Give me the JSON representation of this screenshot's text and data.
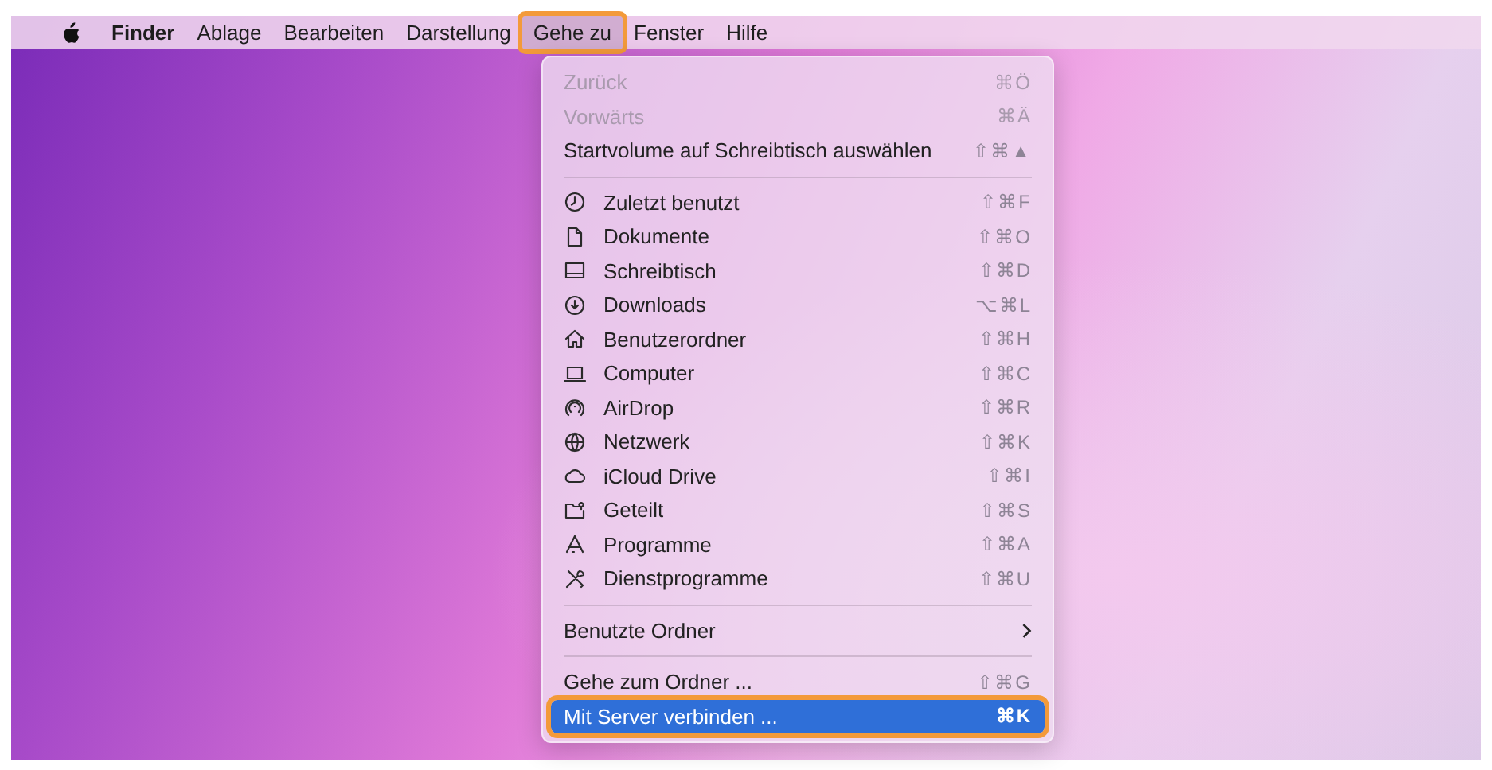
{
  "menubar": {
    "items": [
      {
        "label": "Finder",
        "bold": true,
        "selected": false,
        "outlined": false
      },
      {
        "label": "Ablage",
        "bold": false,
        "selected": false,
        "outlined": false
      },
      {
        "label": "Bearbeiten",
        "bold": false,
        "selected": false,
        "outlined": false
      },
      {
        "label": "Darstellung",
        "bold": false,
        "selected": false,
        "outlined": false
      },
      {
        "label": "Gehe zu",
        "bold": false,
        "selected": true,
        "outlined": true
      },
      {
        "label": "Fenster",
        "bold": false,
        "selected": false,
        "outlined": false
      },
      {
        "label": "Hilfe",
        "bold": false,
        "selected": false,
        "outlined": false
      }
    ]
  },
  "menu": {
    "top_items": [
      {
        "label": "Zurück",
        "shortcut": "⌘Ö",
        "disabled": true,
        "selected": false,
        "outlined": false
      },
      {
        "label": "Vorwärts",
        "shortcut": "⌘Ä",
        "disabled": true,
        "selected": false,
        "outlined": false
      },
      {
        "label": "Startvolume auf Schreibtisch auswählen",
        "shortcut": "⇧⌘▲",
        "disabled": false,
        "selected": false,
        "outlined": false
      }
    ],
    "places": [
      {
        "label": "Zuletzt benutzt",
        "shortcut": "⇧⌘F"
      },
      {
        "label": "Dokumente",
        "shortcut": "⇧⌘O"
      },
      {
        "label": "Schreibtisch",
        "shortcut": "⇧⌘D"
      },
      {
        "label": "Downloads",
        "shortcut": "⌥⌘L"
      },
      {
        "label": "Benutzerordner",
        "shortcut": "⇧⌘H"
      },
      {
        "label": "Computer",
        "shortcut": "⇧⌘C"
      },
      {
        "label": "AirDrop",
        "shortcut": "⇧⌘R"
      },
      {
        "label": "Netzwerk",
        "shortcut": "⇧⌘K"
      },
      {
        "label": "iCloud Drive",
        "shortcut": "⇧⌘I"
      },
      {
        "label": "Geteilt",
        "shortcut": "⇧⌘S"
      },
      {
        "label": "Programme",
        "shortcut": "⇧⌘A"
      },
      {
        "label": "Dienstprogramme",
        "shortcut": "⇧⌘U"
      }
    ],
    "submenu": {
      "label": "Benutzte Ordner"
    },
    "bottom_items": [
      {
        "label": "Gehe zum Ordner ...",
        "shortcut": "⇧⌘G",
        "disabled": false,
        "selected": false,
        "outlined": false
      },
      {
        "label": "Mit Server verbinden ...",
        "shortcut": "⌘K",
        "disabled": false,
        "selected": true,
        "outlined": true
      }
    ]
  }
}
